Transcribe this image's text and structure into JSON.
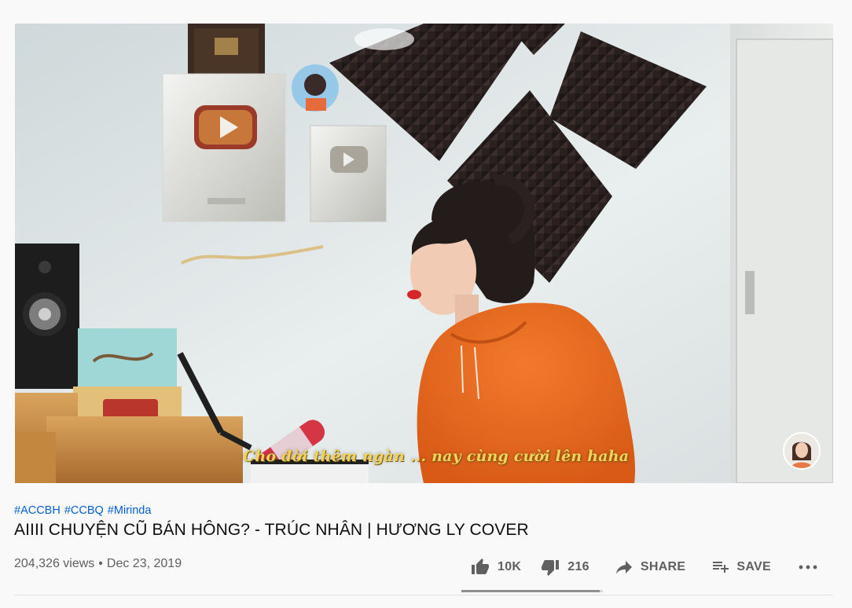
{
  "video": {
    "caption": "Cho đời thêm ngàn ... nay cùng cười lên haha",
    "watermark_icon": "channel-avatar-icon"
  },
  "hashtags": [
    "#ACCBH",
    "#CCBQ",
    "#Mirinda"
  ],
  "title": "AIIII CHUYỆN CŨ BÁN HÔNG? - TRÚC NHÂN | HƯƠNG LY COVER",
  "meta": {
    "views": "204,326 views",
    "separator": "•",
    "date": "Dec 23, 2019"
  },
  "actions": {
    "like_count": "10K",
    "dislike_count": "216",
    "share_label": "SHARE",
    "save_label": "SAVE",
    "like_ratio": 0.979,
    "icons": [
      "thumb-up-icon",
      "thumb-down-icon",
      "share-arrow-icon",
      "playlist-add-icon",
      "more-horizontal-icon"
    ]
  },
  "colors": {
    "hashtag": "#065fd4",
    "text_primary": "#0f0f0f",
    "text_secondary": "#606060",
    "hoodie_orange": "#ea6a1f",
    "caption_gold": "#f2d25a"
  }
}
